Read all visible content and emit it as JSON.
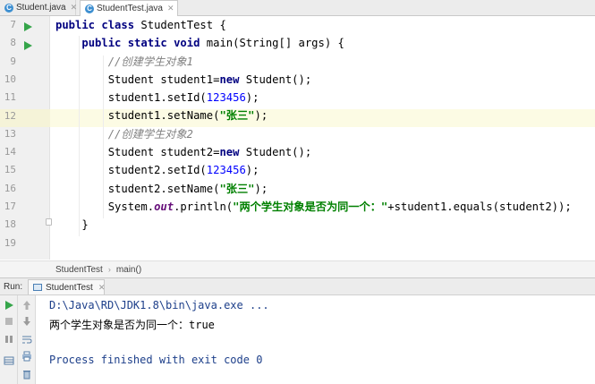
{
  "tabs": [
    {
      "label": "Student.java",
      "active": false
    },
    {
      "label": "StudentTest.java",
      "active": true
    }
  ],
  "editor": {
    "line_numbers": [
      "7",
      "8",
      "9",
      "10",
      "11",
      "12",
      "13",
      "14",
      "15",
      "16",
      "17",
      "18",
      "19"
    ],
    "current_line": "12",
    "lines": [
      [
        [
          "kw",
          "public class "
        ],
        [
          "",
          "StudentTest {"
        ]
      ],
      [
        [
          "",
          "    "
        ],
        [
          "kw",
          "public static void "
        ],
        [
          "",
          "main(String[] args) {"
        ]
      ],
      [
        [
          "",
          "        "
        ],
        [
          "cm",
          "//创建学生对象1"
        ]
      ],
      [
        [
          "",
          "        Student student1="
        ],
        [
          "kw",
          "new "
        ],
        [
          "",
          "Student();"
        ]
      ],
      [
        [
          "",
          "        student1.setId("
        ],
        [
          "num",
          "123456"
        ],
        [
          "",
          ");"
        ]
      ],
      [
        [
          "",
          "        student1.setName("
        ],
        [
          "str",
          "\"张三\""
        ],
        [
          "",
          ");"
        ]
      ],
      [
        [
          "",
          "        "
        ],
        [
          "cm",
          "//创建学生对象2"
        ]
      ],
      [
        [
          "",
          "        Student student2="
        ],
        [
          "kw",
          "new "
        ],
        [
          "",
          "Student();"
        ]
      ],
      [
        [
          "",
          "        student2.setId("
        ],
        [
          "num",
          "123456"
        ],
        [
          "",
          ");"
        ]
      ],
      [
        [
          "",
          "        student2.setName("
        ],
        [
          "str",
          "\"张三\""
        ],
        [
          "",
          ");"
        ]
      ],
      [
        [
          "",
          "        System."
        ],
        [
          "fld",
          "out"
        ],
        [
          "",
          ".println("
        ],
        [
          "str",
          "\"两个学生对象是否为同一个：\""
        ],
        [
          "",
          "+student1.equals(student2));"
        ]
      ],
      [
        [
          "",
          "    }"
        ]
      ],
      [
        [
          "",
          ""
        ]
      ]
    ]
  },
  "breadcrumb": {
    "class": "StudentTest",
    "method": "main()"
  },
  "run_panel": {
    "label": "Run:",
    "tab": "StudentTest",
    "console": {
      "command": "D:\\Java\\RD\\JDK1.8\\bin\\java.exe ...",
      "output": "两个学生对象是否为同一个：true",
      "finished": "Process finished with exit code 0"
    }
  },
  "colors": {
    "keyword": "#000080",
    "string": "#008000",
    "number": "#0000ff",
    "comment": "#808080",
    "run_green": "#35a54a",
    "current_line": "#fcfbe4"
  },
  "icons": [
    "java-class-icon",
    "close-icon",
    "run-icon",
    "fold-icon",
    "rerun-icon",
    "stop-icon",
    "pause-icon",
    "scroll-up-icon",
    "scroll-down-icon",
    "soft-wrap-icon",
    "print-icon",
    "layout-icon"
  ]
}
